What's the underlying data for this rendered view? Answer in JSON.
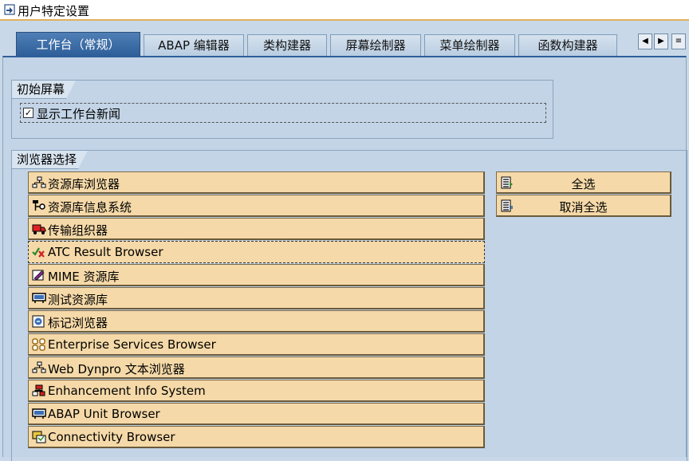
{
  "window": {
    "title": "用户特定设置"
  },
  "tabs": [
    {
      "label": "工作台（常规）",
      "active": true
    },
    {
      "label": "ABAP 编辑器"
    },
    {
      "label": "类构建器"
    },
    {
      "label": "屏幕绘制器"
    },
    {
      "label": "菜单绘制器"
    },
    {
      "label": "函数构建器"
    }
  ],
  "initial_screen": {
    "title": "初始屏幕",
    "checkbox_label": "显示工作台新闻",
    "checkbox_checked": true,
    "checkbox_mark": "✓"
  },
  "browser_selection": {
    "title": "浏览器选择",
    "items": [
      {
        "label": "资源库浏览器",
        "icon": "hierarchy-icon"
      },
      {
        "label": "资源库信息系统",
        "icon": "info-system-icon"
      },
      {
        "label": "传输组织器",
        "icon": "truck-icon"
      },
      {
        "label": "ATC Result Browser",
        "icon": "atc-check-icon"
      },
      {
        "label": "MIME 资源库",
        "icon": "mime-edit-icon"
      },
      {
        "label": "测试资源库",
        "icon": "test-repository-icon"
      },
      {
        "label": "标记浏览器",
        "icon": "bookmark-icon"
      },
      {
        "label": "Enterprise Services Browser",
        "icon": "services-grid-icon"
      },
      {
        "label": "Web Dynpro 文本浏览器",
        "icon": "hierarchy-icon"
      },
      {
        "label": "Enhancement Info System",
        "icon": "enhancement-icon"
      },
      {
        "label": "ABAP Unit Browser",
        "icon": "unit-test-icon"
      },
      {
        "label": "Connectivity Browser",
        "icon": "connectivity-icon"
      }
    ],
    "select_all_label": "全选",
    "deselect_all_label": "取消全选"
  }
}
